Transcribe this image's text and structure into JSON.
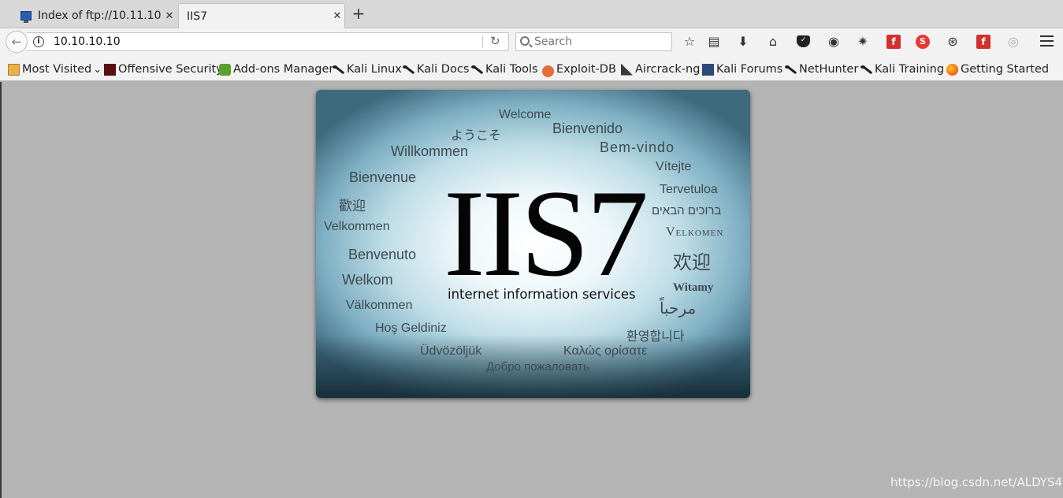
{
  "tabs": [
    {
      "label": "Index of ftp://10.11.10...",
      "close": "✕"
    },
    {
      "label": "IIS7",
      "close": "✕"
    }
  ],
  "new_tab": "+",
  "nav": {
    "back": "←",
    "info": "i",
    "url": "10.10.10.10",
    "reload": "↻",
    "search_placeholder": "Search"
  },
  "bookmarks": [
    {
      "label": "Most Visited",
      "caret": "⌄"
    },
    {
      "label": "Offensive Security"
    },
    {
      "label": "Add-ons Manager"
    },
    {
      "label": "Kali Linux"
    },
    {
      "label": "Kali Docs"
    },
    {
      "label": "Kali Tools"
    },
    {
      "label": "Exploit-DB"
    },
    {
      "label": "Aircrack-ng"
    },
    {
      "label": "Kali Forums"
    },
    {
      "label": "NetHunter"
    },
    {
      "label": "Kali Training"
    },
    {
      "label": "Getting Started"
    }
  ],
  "page": {
    "logo": "IIS7",
    "subtitle": "internet information services",
    "greetings": [
      "Welcome",
      "ようこそ",
      "Bienvenido",
      "Willkommen",
      "Bem-vindo",
      "Vítejte",
      "Bienvenue",
      "Tervetuloa",
      "歡迎",
      "ברוכים הבאים",
      "Velkommen",
      "Velkomen",
      "Benvenuto",
      "欢迎",
      "Welkom",
      "Witamy",
      "Välkommen",
      "مرحباً",
      "Hoş Geldiniz",
      "환영합니다",
      "Üdvözöljük",
      "Καλώς ορίσατε",
      "Добро пожаловать"
    ]
  },
  "watermark": "https://blog.csdn.net/ALDYS4",
  "colors": {
    "accent": "#d32f2f",
    "page_bg": "#b4b4b4"
  }
}
